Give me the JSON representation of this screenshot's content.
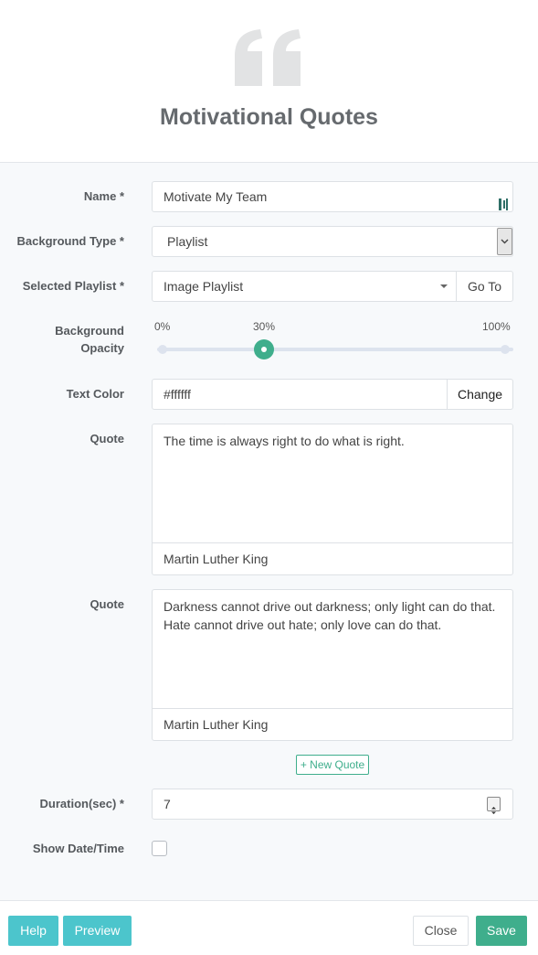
{
  "header": {
    "title": "Motivational Quotes",
    "icon": "quote-icon"
  },
  "form": {
    "name": {
      "label": "Name *",
      "value": "Motivate My Team"
    },
    "background_type": {
      "label": "Background Type *",
      "value": "Playlist"
    },
    "selected_playlist": {
      "label": "Selected Playlist *",
      "value": "Image Playlist",
      "goto_label": "Go To"
    },
    "background_opacity": {
      "label_line1": "Background",
      "label_line2": "Opacity",
      "min_label": "0%",
      "current_label": "30%",
      "max_label": "100%",
      "value": 30
    },
    "text_color": {
      "label": "Text Color",
      "value": "#ffffff",
      "change_label": "Change"
    },
    "quotes": [
      {
        "label": "Quote",
        "text": "The time is always right to do what is right.",
        "author": "Martin Luther King"
      },
      {
        "label": "Quote",
        "text": "Darkness cannot drive out darkness; only light can do that. Hate cannot drive out hate; only love can do that.",
        "author": "Martin Luther King"
      }
    ],
    "new_quote_label": "+ New Quote",
    "duration": {
      "label": "Duration(sec) *",
      "value": "7"
    },
    "show_datetime": {
      "label": "Show Date/Time",
      "checked": false
    }
  },
  "footer": {
    "help": "Help",
    "preview": "Preview",
    "close": "Close",
    "save": "Save"
  },
  "colors": {
    "accent": "#3fae8c",
    "teal": "#4cc5cc",
    "logo_gray": "#e2e3e4"
  }
}
